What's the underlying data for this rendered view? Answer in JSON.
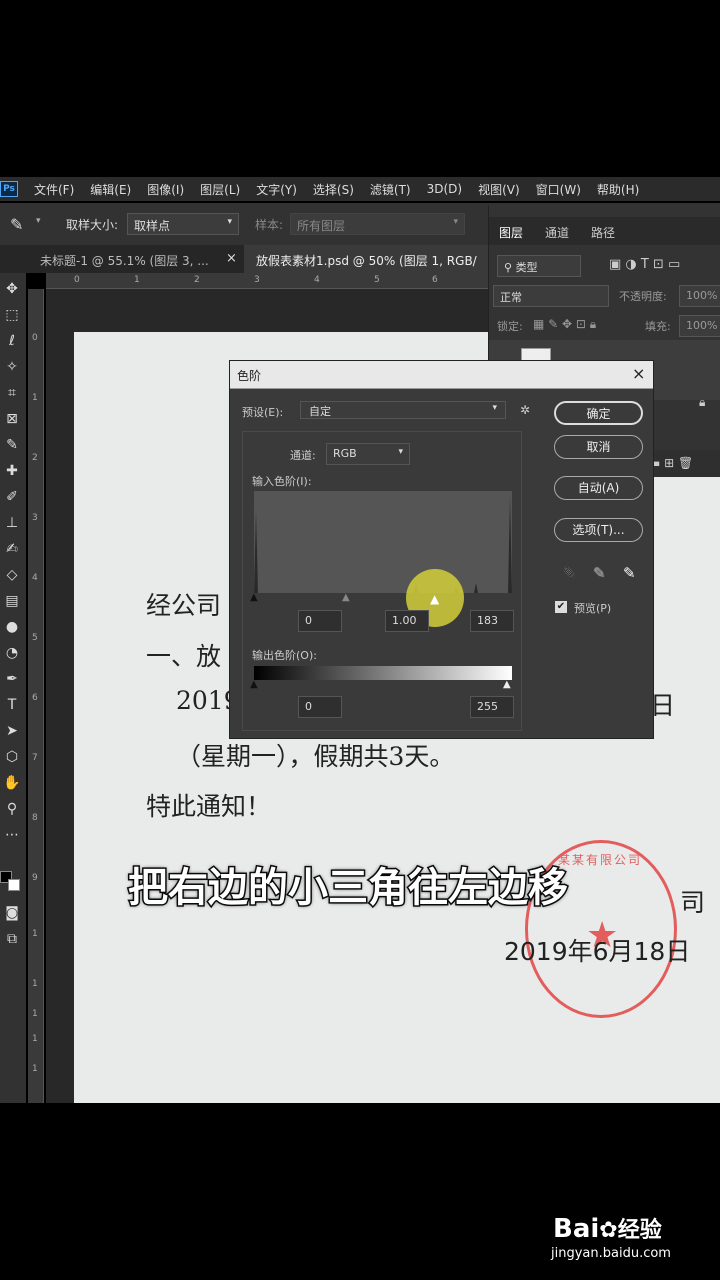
{
  "menubar": {
    "app_icon": "Ps",
    "items": [
      "文件(F)",
      "编辑(E)",
      "图像(I)",
      "图层(L)",
      "文字(Y)",
      "选择(S)",
      "滤镜(T)",
      "3D(D)",
      "视图(V)",
      "窗口(W)",
      "帮助(H)"
    ]
  },
  "options": {
    "sample_size_label": "取样大小:",
    "sample_size_value": "取样点",
    "sample_label": "样本:",
    "sample_value": "所有图层"
  },
  "tabs": [
    {
      "label": "未标题-1 @ 55.1% (图层 3, ...",
      "close": "×"
    },
    {
      "label": "放假表素材1.psd @ 50% (图层 1, RGB/"
    }
  ],
  "ruler_h": [
    "0",
    "1",
    "2",
    "3",
    "4",
    "5",
    "6"
  ],
  "ruler_v": [
    "0",
    "1",
    "2",
    "3",
    "4",
    "5",
    "6",
    "7",
    "8",
    "9",
    "1",
    "1",
    "1",
    "1",
    "1"
  ],
  "layers_panel": {
    "tabs": [
      "图层",
      "通道",
      "路径"
    ],
    "filter": "类型",
    "blend": "正常",
    "opacity_label": "不透明度:",
    "opacity": "100%",
    "lock_label": "锁定:",
    "fill_label": "填充:",
    "fill": "100%"
  },
  "document": {
    "line1": "经公司",
    "line2": "一、放",
    "line3a": "2019",
    "line3b": "日",
    "line4": "（星期一），假期共3天。",
    "line5": "特此通知！",
    "company_tail": "司",
    "date": "2019年6月18日",
    "stamp_text": "某某有限公司"
  },
  "dialog": {
    "title": "色阶",
    "close": "×",
    "preset_label": "预设(E):",
    "preset_value": "自定",
    "channel_label": "通道:",
    "channel_value": "RGB",
    "input_label": "输入色阶(I):",
    "input_black": "0",
    "input_mid": "1.00",
    "input_white": "183",
    "output_label": "输出色阶(O):",
    "output_black": "0",
    "output_white": "255",
    "ok": "确定",
    "cancel": "取消",
    "auto": "自动(A)",
    "options": "选项(T)...",
    "preview": "预览(P)"
  },
  "caption": "把右边的小三角往左边移",
  "watermark": {
    "brand": "Bai",
    "brand2": "经验",
    "url": "jingyan.baidu.com"
  },
  "colors": {
    "ps_dark": "#323232",
    "doc": "#e9eaea",
    "stamp": "#e23a3a",
    "highlight": "#d4cf3a"
  }
}
